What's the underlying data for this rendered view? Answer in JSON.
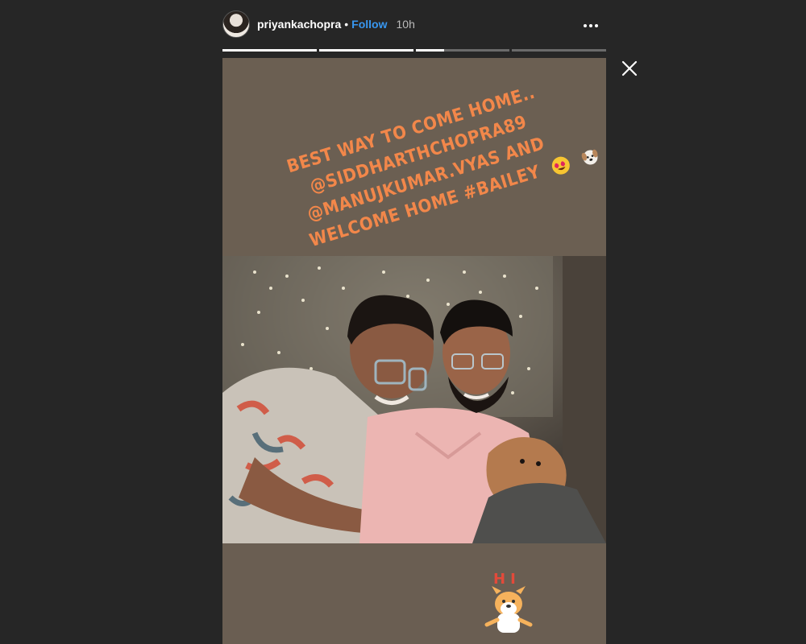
{
  "header": {
    "username": "priyankachopra",
    "separator": "•",
    "follow_label": "Follow",
    "time": "10h"
  },
  "progress": [
    1.0,
    1.0,
    0.3,
    0.0
  ],
  "story": {
    "caption_lines": [
      "BEST WAY TO COME HOME..",
      "@SIDDHARTHCHOPRA89",
      "@MANUJKUMAR.VYAS AND",
      "WELCOME HOME #BAILEY"
    ],
    "caption_emojis": [
      "heart-eyes",
      "dog"
    ],
    "sticker_text": "HI"
  },
  "icons": {
    "more": "more-options-icon",
    "close": "close-icon"
  },
  "colors": {
    "background": "#262626",
    "follow": "#3897f0",
    "caption": "#f2874a",
    "story_bg": "#6b5f52"
  }
}
